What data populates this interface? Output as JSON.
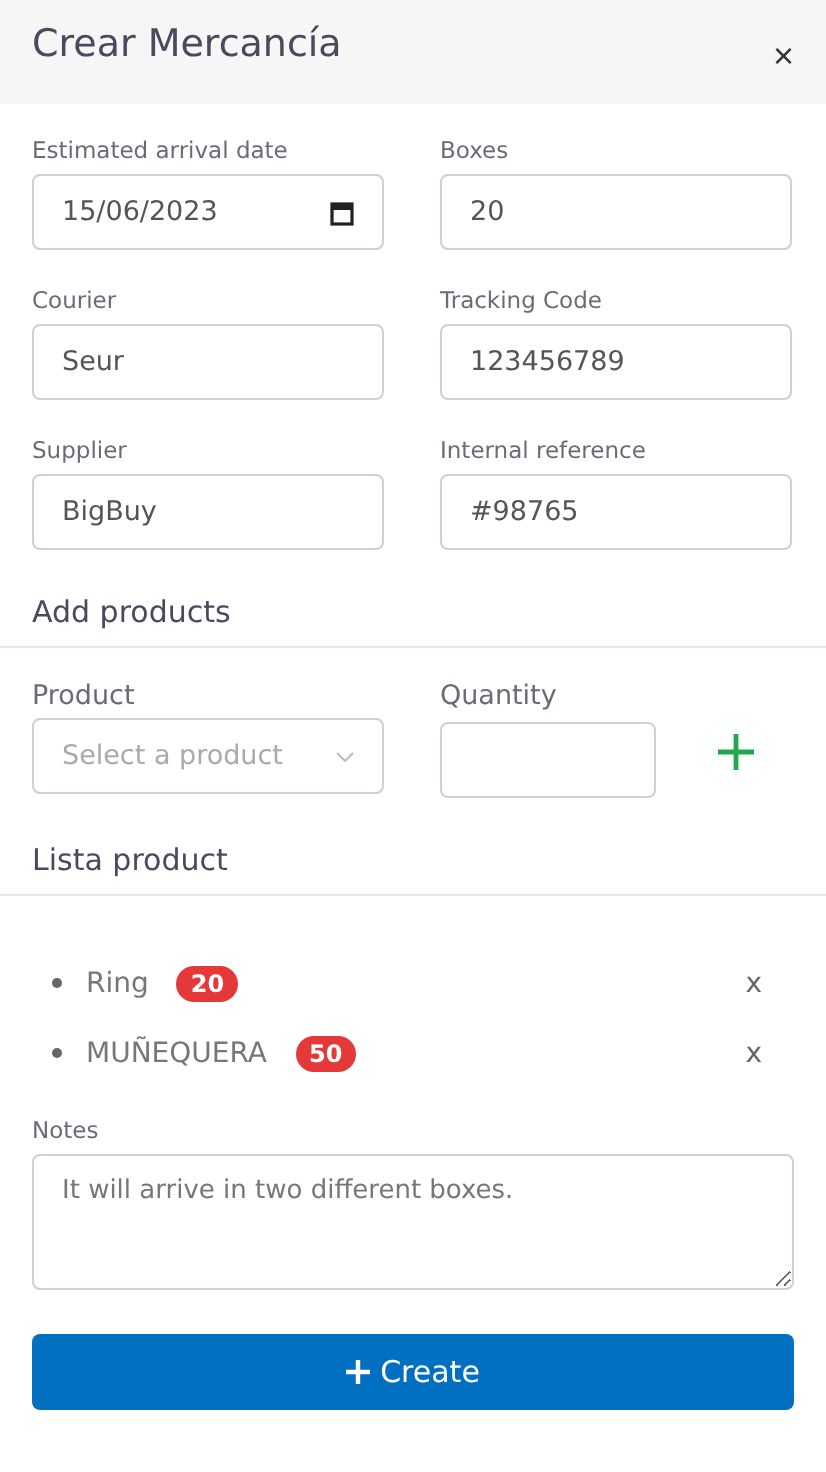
{
  "window": {
    "title": "Crear Mercancía",
    "close": "×"
  },
  "fields": [
    {
      "label": "Estimated arrival date",
      "value": "15/06/2023",
      "kind": "date"
    },
    {
      "label": "Boxes",
      "value": "20",
      "kind": "text"
    },
    {
      "label": "Courier",
      "value": "Seur",
      "kind": "text"
    },
    {
      "label": "Tracking Code",
      "value": "123456789",
      "kind": "text"
    },
    {
      "label": "Supplier",
      "value": "BigBuy",
      "kind": "text"
    },
    {
      "label": "Internal reference",
      "value": "#98765",
      "kind": "text"
    }
  ],
  "add_products": {
    "heading": "Add products",
    "product_label": "Product",
    "product_placeholder": "Select a product",
    "quantity_label": "Quantity"
  },
  "product_list": {
    "heading": "Lista product",
    "items": [
      {
        "name": "Ring",
        "count": "20",
        "remove": "x"
      },
      {
        "name": "MUÑEQUERA",
        "count": "50",
        "remove": "x"
      }
    ]
  },
  "notes": {
    "label": "Notes",
    "value": "It will arrive in two different boxes."
  },
  "create_button": {
    "label": "Create"
  }
}
